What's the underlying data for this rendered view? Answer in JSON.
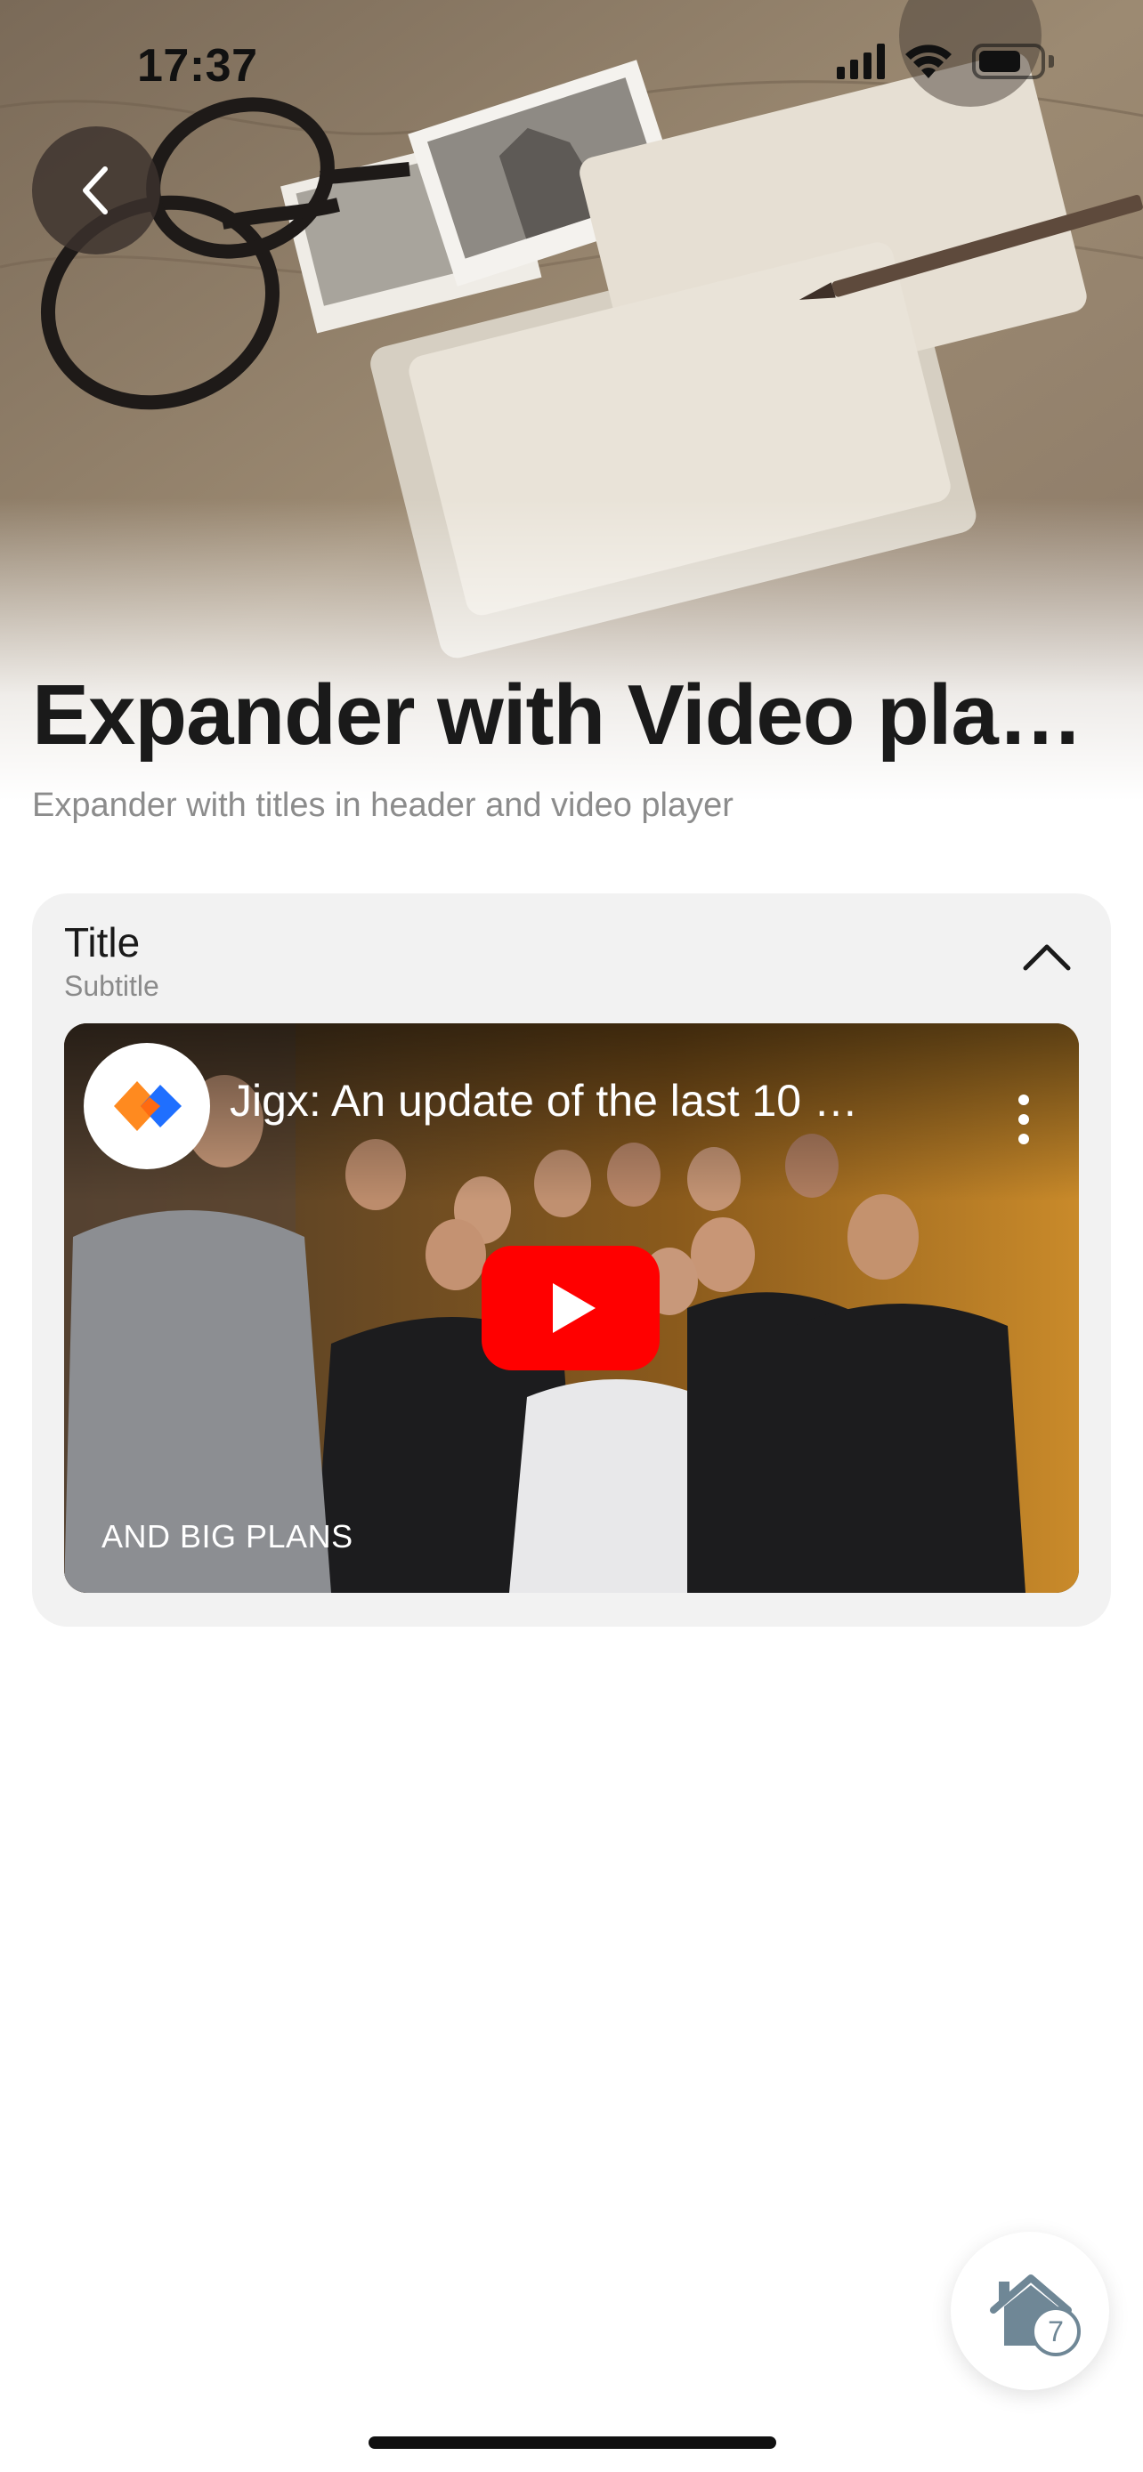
{
  "status_bar": {
    "time": "17:37"
  },
  "header": {
    "title": "Expander with Video pla…",
    "subtitle": "Expander with titles in header and video player"
  },
  "expander": {
    "title": "Title",
    "subtitle": "Subtitle",
    "expanded": true,
    "video": {
      "title": "Jigx: An update of the last 10 …",
      "caption": "AND BIG PLANS",
      "player_color": "#ff0000"
    }
  },
  "home_button": {
    "badge": "7"
  },
  "colors": {
    "accent_orange": "#ff8a1f",
    "accent_blue": "#1f6fff",
    "home_icon": "#6f8796"
  }
}
